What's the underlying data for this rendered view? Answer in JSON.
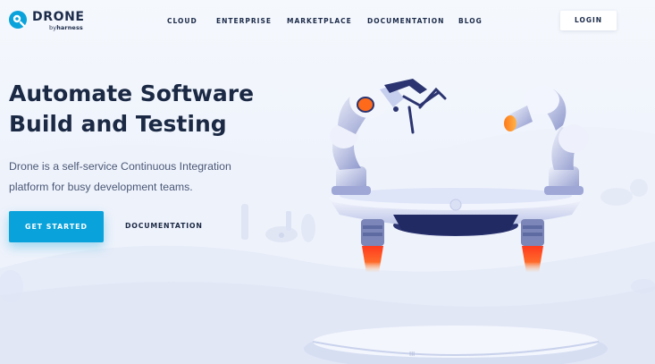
{
  "brand": {
    "name": "DRONE",
    "sub_prefix": "by",
    "sub_name": "harness",
    "accent": "#0aa2db",
    "text_color": "#1b2944"
  },
  "nav": {
    "items": [
      {
        "label": "CLOUD"
      },
      {
        "label": "ENTERPRISE"
      },
      {
        "label": "MARKETPLACE"
      },
      {
        "label": "DOCUMENTATION"
      },
      {
        "label": "BLOG"
      }
    ],
    "login_label": "LOGIN"
  },
  "hero": {
    "headline_line1": "Automate Software",
    "headline_line2": "Build and Testing",
    "sub_line1": "Drone is a self-service Continuous Integration",
    "sub_line2": "platform for busy development teams.",
    "cta_label": "GET STARTED",
    "secondary_label": "DOCUMENTATION"
  },
  "illustration": {
    "pad_number": "III"
  }
}
